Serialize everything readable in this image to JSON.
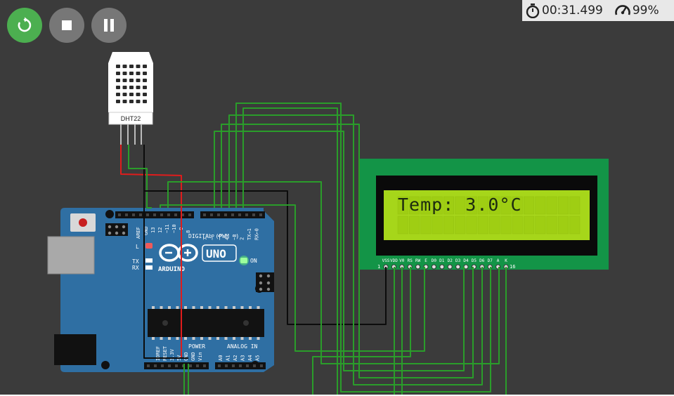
{
  "toolbar": {
    "restart": "restart-icon",
    "stop": "stop-icon",
    "pause": "pause-icon"
  },
  "status": {
    "timer": "00:31.499",
    "speed": "99%"
  },
  "dht": {
    "label": "DHT22"
  },
  "lcd": {
    "text": "Temp: 3.0°C",
    "pin_labels": [
      "VSS",
      "VDD",
      "V0",
      "RS",
      "RW",
      "E",
      "D0",
      "D1",
      "D2",
      "D3",
      "D4",
      "D5",
      "D6",
      "D7",
      "A",
      "K"
    ],
    "pin_first": "1",
    "pin_last": "16"
  },
  "arduino": {
    "brand": "ARDUINO",
    "model": "UNO",
    "digital_label": "DIGITAL (PWM ~)",
    "power_label": "POWER",
    "analog_label": "ANALOG IN",
    "on_label": "ON",
    "l_label": "L",
    "tx_label": "TX",
    "rx_label": "RX",
    "aref_label": "AREF",
    "gnd_label": "GND",
    "digital_pins": [
      "13",
      "12",
      "~11",
      "~10",
      "~9",
      "8",
      "7",
      "~6",
      "~5",
      "4",
      "~3",
      "2",
      "TX→1",
      "RX←0"
    ],
    "power_pins": [
      "IOREF",
      "RESET",
      "3.3V",
      "5V",
      "GND",
      "GND",
      "Vin"
    ],
    "analog_pins": [
      "A0",
      "A1",
      "A2",
      "A3",
      "A4",
      "A5"
    ]
  },
  "colors": {
    "canvas": "#3b3b3b",
    "wire_green": "#2a9d2a",
    "wire_red": "#e01c1c",
    "wire_black": "#0c0c0c",
    "board": "#2f6fa3",
    "lcd_pcb": "#139447",
    "lcd_screen": "#a6d61a"
  }
}
